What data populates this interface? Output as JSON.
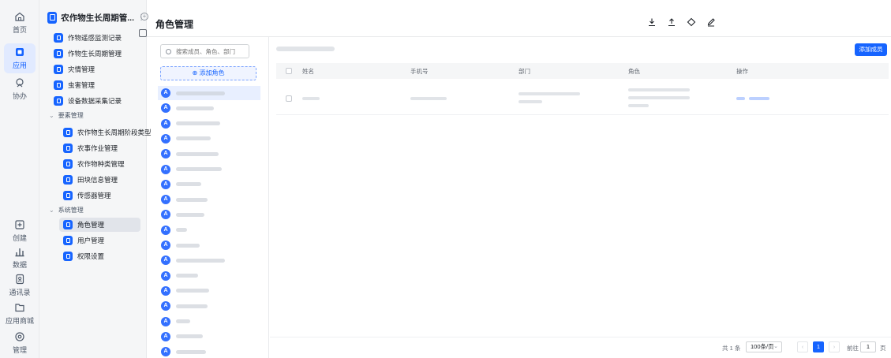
{
  "rail": {
    "items": [
      {
        "label": "首页",
        "icon": "home-icon"
      },
      {
        "label": "应用",
        "icon": "app-icon",
        "active": true
      },
      {
        "label": "协办",
        "icon": "collab-icon"
      },
      {
        "label": "创建",
        "icon": "create-icon"
      },
      {
        "label": "数据",
        "icon": "data-icon"
      },
      {
        "label": "通讯录",
        "icon": "contacts-icon"
      },
      {
        "label": "应用商城",
        "icon": "store-icon"
      },
      {
        "label": "管理",
        "icon": "manage-icon"
      }
    ]
  },
  "app": {
    "title": "农作物生长周期管...",
    "more": "⋮"
  },
  "menu": {
    "top_items": [
      "作物遥感监测记录",
      "作物生长周期管理",
      "灾情管理",
      "虫害管理",
      "设备数据采集记录"
    ],
    "group1": {
      "label": "要素管理",
      "items": [
        "农作物生长周期阶段类型",
        "农事作业管理",
        "农作物种类管理",
        "田块信息管理",
        "传感器管理"
      ]
    },
    "group2": {
      "label": "系统管理",
      "items": [
        "角色管理",
        "用户管理",
        "权限设置"
      ],
      "active_index": 0
    }
  },
  "page": {
    "title": "角色管理"
  },
  "header_icons": [
    "download-icon",
    "upload-icon",
    "diamond-icon",
    "edit-icon"
  ],
  "roles": {
    "search_placeholder": "搜索成员、角色、部门",
    "add_label": "⊕ 添加角色",
    "count": 18,
    "active_index": 0
  },
  "members": {
    "add_button": "添加成员",
    "columns": [
      "姓名",
      "手机号",
      "部门",
      "角色",
      "操作"
    ]
  },
  "pagination": {
    "total": "共 1 条",
    "page_size": "100条/页",
    "current_page": "1",
    "goto_label": "前往",
    "goto_value": "1",
    "page_unit": "页"
  },
  "colors": {
    "accent": "#1664ff",
    "menu_bg": "#f5f6f7"
  }
}
